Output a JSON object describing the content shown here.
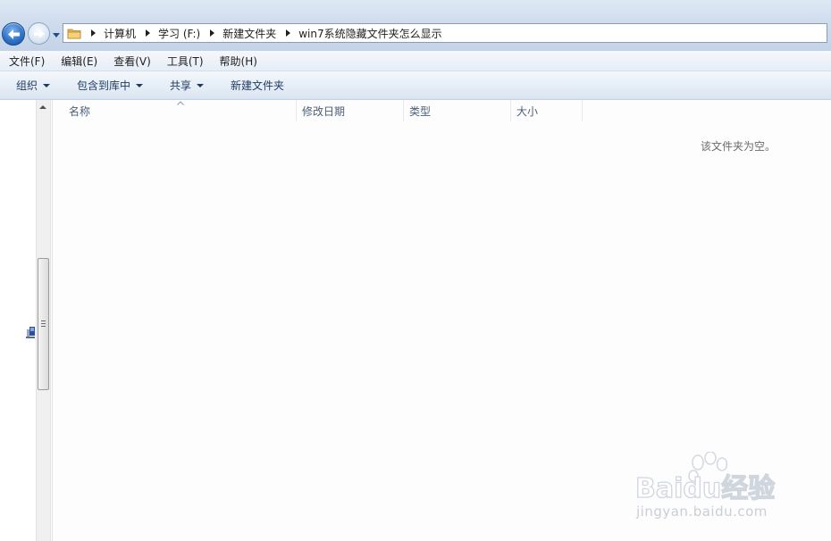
{
  "breadcrumb": [
    "计算机",
    "学习 (F:)",
    "新建文件夹",
    "win7系统隐藏文件夹怎么显示"
  ],
  "menubar": {
    "items": [
      "文件(F)",
      "编辑(E)",
      "查看(V)",
      "工具(T)",
      "帮助(H)"
    ]
  },
  "toolbar": {
    "organize": "组织",
    "include_library": "包含到库中",
    "share": "共享",
    "new_folder": "新建文件夹"
  },
  "columns": [
    "名称",
    "修改日期",
    "类型",
    "大小"
  ],
  "empty_message": "该文件夹为空。",
  "watermark": {
    "logo_text": "Baidu经验",
    "url": "jingyan.baidu.com"
  },
  "colors": {
    "address_area": "#cfdcec",
    "command_bar": "#e7eef7",
    "back_button": "#2f74c9",
    "column_header_text": "#4c607a"
  },
  "icons": [
    "back-arrow-icon",
    "forward-arrow-icon",
    "dropdown-icon",
    "folder-icon",
    "breadcrumb-arrow-icon",
    "sort-up-icon",
    "scroll-up-icon"
  ]
}
